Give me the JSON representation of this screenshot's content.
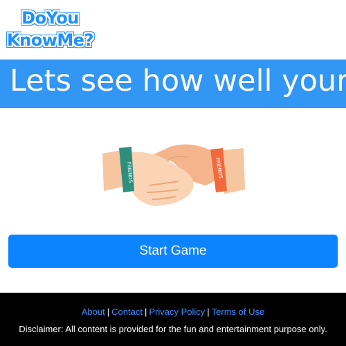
{
  "logo": {
    "line1": "DoYou",
    "line2": "KnowMe?"
  },
  "banner": {
    "text": "Lets see how well your"
  },
  "illustration": {
    "icon": "handshake-icon",
    "left_band_text": "FRIENDS",
    "right_band_text": "FRIENDS"
  },
  "start_button": {
    "label": "Start Game"
  },
  "footer": {
    "links": {
      "about": "About",
      "contact": "Contact",
      "privacy": "Privacy Policy",
      "terms": "Terms of Use"
    },
    "separator": "|",
    "disclaimer": "Disclaimer: All content is provided for the fun and entertainment purpose only."
  },
  "colors": {
    "brand_blue": "#3296f5",
    "button_blue": "#0d84ff",
    "footer_bg": "#000000",
    "link_blue": "#3a8eff"
  }
}
